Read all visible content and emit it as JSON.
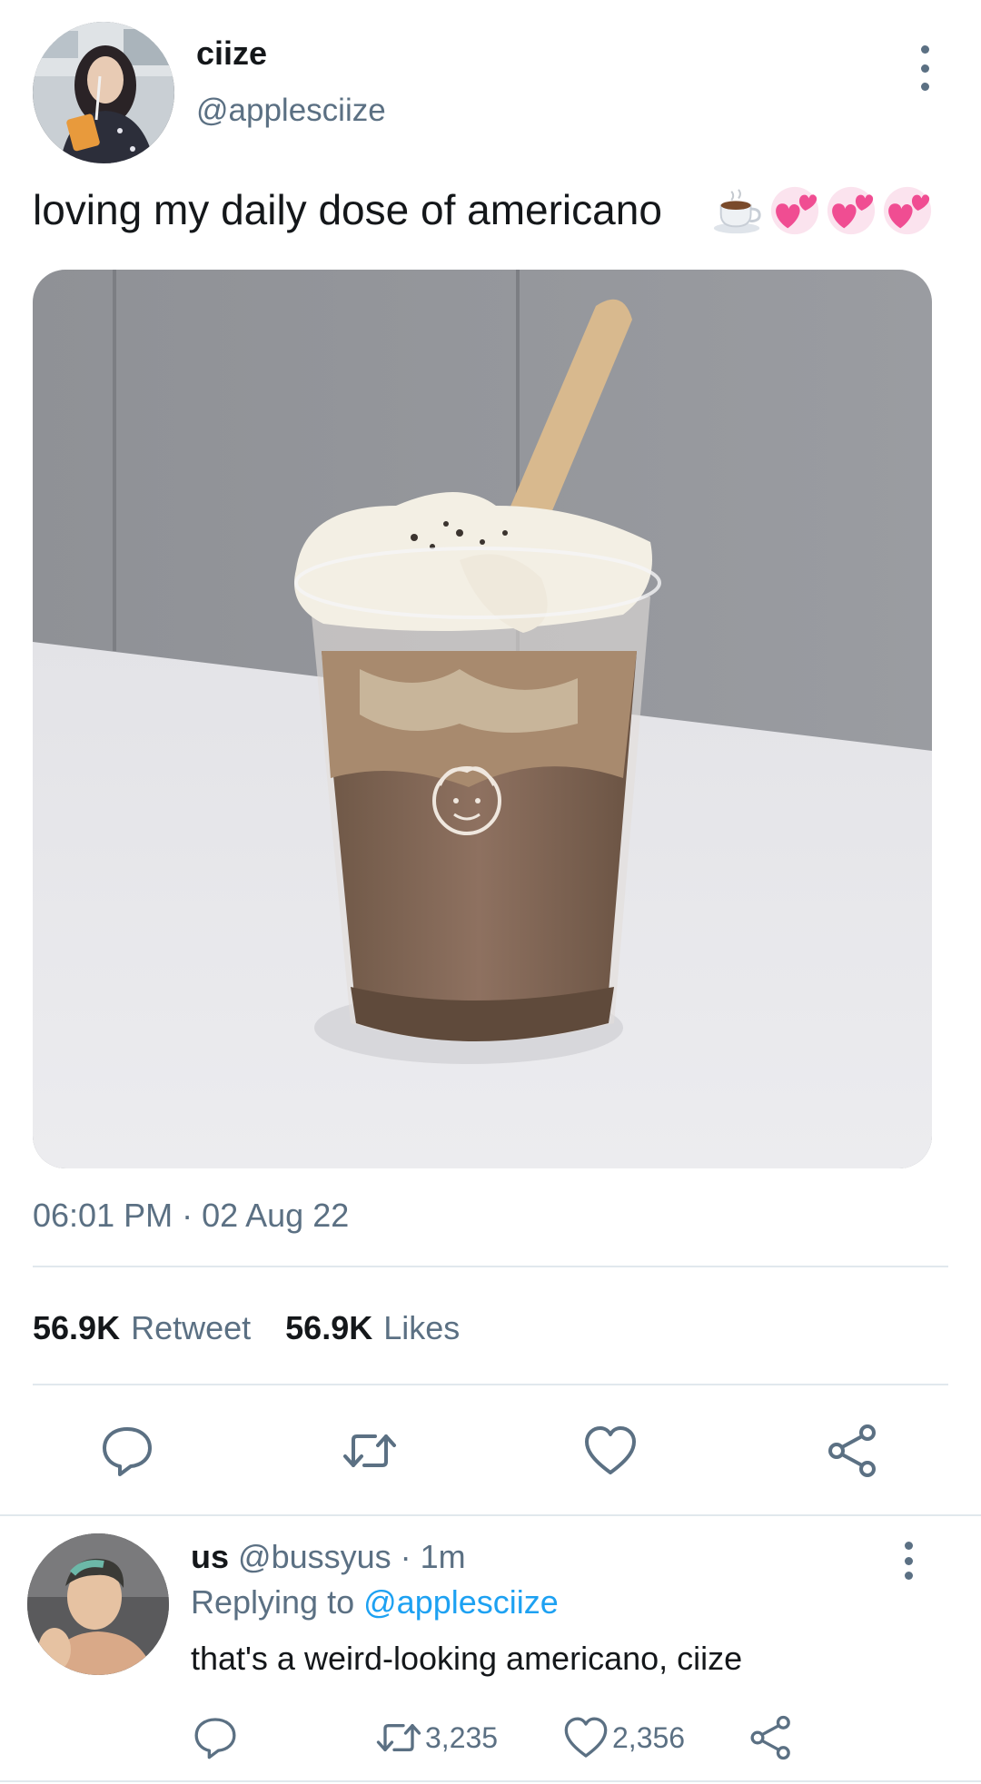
{
  "tweet": {
    "author": {
      "display_name": "ciize",
      "handle": "@applesciize"
    },
    "text": "loving my daily dose of americano",
    "emojis": [
      "coffee-cup",
      "two-hearts",
      "two-hearts",
      "two-hearts"
    ],
    "timestamp": "06:01 PM · 02 Aug 22",
    "stats": {
      "retweets_count": "56.9K",
      "retweets_label": "Retweet",
      "likes_count": "56.9K",
      "likes_label": "Likes"
    },
    "actions": [
      "reply-icon",
      "retweet-icon",
      "like-icon",
      "share-icon"
    ]
  },
  "reply": {
    "display_name": "us",
    "handle_meta": "@bussyus · 1m",
    "replying_prefix": "Replying to",
    "replying_to": "@applesciize",
    "text": "that's a weird-looking americano, ciize",
    "retweets": "3,235",
    "likes": "2,356"
  },
  "colors": {
    "text_primary": "#14171a",
    "text_secondary": "#5b7083",
    "link": "#1da1f2",
    "divider": "#e1e8ed",
    "icon": "#5b7083"
  }
}
